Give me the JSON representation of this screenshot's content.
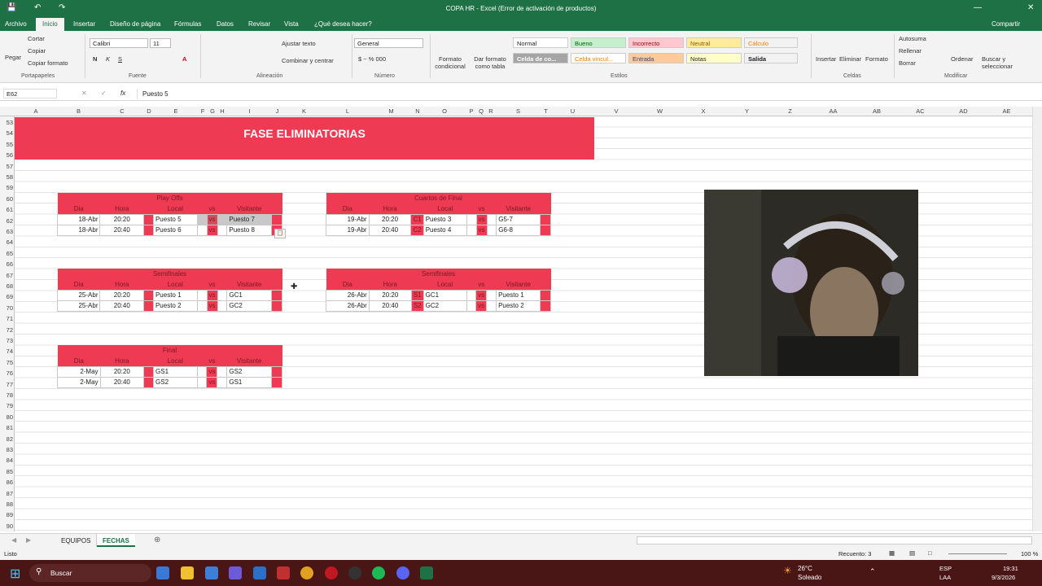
{
  "window": {
    "title": "COPA HR - Excel (Error de activación de productos)"
  },
  "tabs": [
    "Archivo",
    "Inicio",
    "Insertar",
    "Diseño de página",
    "Fórmulas",
    "Datos",
    "Revisar",
    "Vista",
    "¿Qué desea hacer?"
  ],
  "ribbon": {
    "clipboard": {
      "paste": "Pegar",
      "cut": "Cortar",
      "copy": "Copiar",
      "format_painter": "Copiar formato",
      "label": "Portapapeles"
    },
    "font": {
      "name": "Calibri",
      "size": "11",
      "label": "Fuente"
    },
    "alignment": {
      "wrap": "Ajustar texto",
      "merge": "Combinar y centrar",
      "label": "Alineación"
    },
    "number": {
      "format": "General",
      "label": "Número"
    },
    "styles": {
      "cond_format": "Formato condicional",
      "table_format": "Dar formato como tabla",
      "label": "Estilos",
      "cells": [
        "Normal",
        "Bueno",
        "Incorrecto",
        "Neutral",
        "Cálculo",
        "Celda de co...",
        "Celda vincul...",
        "Entrada",
        "Notas",
        "Salida"
      ]
    },
    "cells": {
      "insert": "Insertar",
      "delete": "Eliminar",
      "format": "Formato",
      "label": "Celdas"
    },
    "edit": {
      "autosum": "Autosuma",
      "fill": "Rellenar",
      "clear": "Borrar",
      "sort": "Ordenar",
      "find": "Buscar y seleccionar",
      "label": "Modificar"
    },
    "share": "Compartir"
  },
  "formula_bar": {
    "name_box": "E62",
    "content": "Puesto 5"
  },
  "columns": [
    "A",
    "B",
    "C",
    "D",
    "E",
    "F",
    "G",
    "H",
    "I",
    "J",
    "K",
    "L",
    "M",
    "N",
    "O",
    "P",
    "Q",
    "R",
    "S",
    "T",
    "U",
    "V",
    "W",
    "X",
    "Y",
    "Z",
    "AA",
    "AB",
    "AC",
    "AD",
    "AE"
  ],
  "rows": [
    "53",
    "54",
    "55",
    "56",
    "57",
    "58",
    "59",
    "60",
    "61",
    "62",
    "63",
    "64",
    "65",
    "66",
    "67",
    "68",
    "69",
    "70",
    "71",
    "72",
    "73",
    "74",
    "75",
    "76",
    "77",
    "78",
    "79",
    "80",
    "81",
    "82",
    "83",
    "84",
    "85",
    "86",
    "87",
    "88",
    "89",
    "90"
  ],
  "banner": "FASE ELIMINATORIAS",
  "headers": {
    "dia": "Dia",
    "hora": "Hora",
    "local": "Local",
    "vs": "vs",
    "visitante": "Visitante"
  },
  "playoffs": {
    "title": "Play Offs",
    "rows": [
      {
        "dia": "18-Abr",
        "hora": "20:20",
        "local": "Puesto 5",
        "vs": "vs",
        "visitante": "Puesto 7"
      },
      {
        "dia": "18-Abr",
        "hora": "20:40",
        "local": "Puesto 6",
        "vs": "vs",
        "visitante": "Puesto 8"
      }
    ]
  },
  "cuartos": {
    "title": "Cuartos de Final",
    "rows": [
      {
        "dia": "19-Abr",
        "hora": "20:20",
        "tag": "C1",
        "local": "Puesto 3",
        "vs": "vs",
        "visitante": "G5-7"
      },
      {
        "dia": "19-Abr",
        "hora": "20:40",
        "tag": "C2",
        "local": "Puesto 4",
        "vs": "vs",
        "visitante": "G6-8"
      }
    ]
  },
  "semis_left": {
    "title": "Semifinales",
    "rows": [
      {
        "dia": "25-Abr",
        "hora": "20:20",
        "local": "Puesto 1",
        "vs": "vs",
        "visitante": "GC1"
      },
      {
        "dia": "25-Abr",
        "hora": "20:40",
        "local": "Puesto 2",
        "vs": "vs",
        "visitante": "GC2"
      }
    ]
  },
  "semis_right": {
    "title": "Semifinales",
    "rows": [
      {
        "dia": "26-Abr",
        "hora": "20:20",
        "tag": "S1",
        "local": "GC1",
        "vs": "vs",
        "visitante": "Puesto 1"
      },
      {
        "dia": "26-Abr",
        "hora": "20:40",
        "tag": "S2",
        "local": "GC2",
        "vs": "vs",
        "visitante": "Puesto 2"
      }
    ]
  },
  "final": {
    "title": "Final",
    "rows": [
      {
        "dia": "2-May",
        "hora": "20:20",
        "local": "GS1",
        "vs": "vs",
        "visitante": "GS2"
      },
      {
        "dia": "2-May",
        "hora": "20:40",
        "local": "GS2",
        "vs": "vs",
        "visitante": "GS1"
      }
    ]
  },
  "sheets": [
    "EQUIPOS",
    "FECHAS"
  ],
  "status": {
    "ready": "Listo",
    "count": "Recuento: 3",
    "zoom": "100 %"
  },
  "taskbar": {
    "search": "Buscar",
    "weather_temp": "26°C",
    "weather_desc": "Soleado",
    "lang1": "ESP",
    "lang2": "LAA",
    "time": "19:31",
    "date": "9/3/2026"
  },
  "colors": {
    "excel_green": "#1e7145",
    "header_red": "#ee3a52"
  }
}
